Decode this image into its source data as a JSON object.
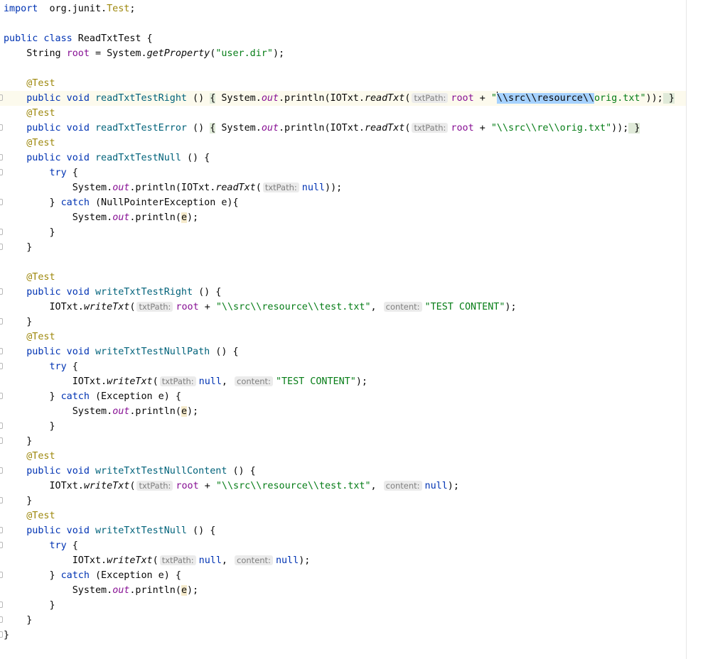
{
  "editor": {
    "lines": [
      {
        "tokens": [
          [
            "kw",
            "import"
          ],
          [
            "",
            "  org.junit."
          ],
          [
            "ann",
            "Test"
          ],
          [
            "",
            ";"
          ]
        ]
      },
      {
        "tokens": []
      },
      {
        "tokens": [
          [
            "kw",
            "public"
          ],
          [
            "",
            ""
          ],
          [
            "kw",
            " class"
          ],
          [
            "",
            " ReadTxtTest {"
          ]
        ]
      },
      {
        "tokens": [
          [
            "",
            "    String "
          ],
          [
            "fld",
            "root"
          ],
          [
            "",
            " = System."
          ],
          [
            "mi",
            "getProperty"
          ],
          [
            "",
            "("
          ],
          [
            "str",
            "\"user.dir\""
          ],
          [
            "",
            ");"
          ]
        ]
      },
      {
        "tokens": []
      },
      {
        "tokens": [
          [
            "ann",
            "    @Test"
          ]
        ]
      },
      {
        "tokens": [
          [
            "kw",
            "    public void "
          ],
          [
            "mdecl",
            "readTxtTestRight"
          ],
          [
            "",
            " () "
          ],
          [
            "brace-hl",
            "{"
          ],
          [
            "",
            " System."
          ],
          [
            "fldi",
            "out"
          ],
          [
            "",
            ".println(IOTxt."
          ],
          [
            "mi",
            "readTxt"
          ],
          [
            "",
            "("
          ],
          [
            "hint",
            "txtPath:"
          ],
          [
            "fld",
            "root"
          ],
          [
            "",
            " + "
          ],
          [
            "str",
            "\""
          ],
          [
            "caret",
            ""
          ],
          [
            "sel",
            "\\\\src\\\\resource\\\\"
          ],
          [
            "str",
            "orig.txt\""
          ],
          [
            "",
            "));"
          ],
          [
            "brace-hl",
            " }"
          ]
        ],
        "current": true
      },
      {
        "tokens": [
          [
            "ann",
            "    @Test"
          ]
        ]
      },
      {
        "tokens": [
          [
            "kw",
            "    public void "
          ],
          [
            "mdecl",
            "readTxtTestError"
          ],
          [
            "",
            " () "
          ],
          [
            "brace-hl",
            "{"
          ],
          [
            "",
            " System."
          ],
          [
            "fldi",
            "out"
          ],
          [
            "",
            ".println(IOTxt."
          ],
          [
            "mi",
            "readTxt"
          ],
          [
            "",
            "("
          ],
          [
            "hint",
            "txtPath:"
          ],
          [
            "fld",
            "root"
          ],
          [
            "",
            " + "
          ],
          [
            "str",
            "\"\\\\src\\\\re\\\\orig.txt\""
          ],
          [
            "",
            "));"
          ],
          [
            "brace-hl",
            " }"
          ]
        ]
      },
      {
        "tokens": [
          [
            "ann",
            "    @Test"
          ]
        ]
      },
      {
        "tokens": [
          [
            "kw",
            "    public void "
          ],
          [
            "mdecl",
            "readTxtTestNull"
          ],
          [
            "",
            " () {"
          ]
        ]
      },
      {
        "tokens": [
          [
            "kw",
            "        try"
          ],
          [
            "",
            " {"
          ]
        ]
      },
      {
        "tokens": [
          [
            "",
            "            System."
          ],
          [
            "fldi",
            "out"
          ],
          [
            "",
            ".println(IOTxt."
          ],
          [
            "mi",
            "readTxt"
          ],
          [
            "",
            "("
          ],
          [
            "hint",
            "txtPath:"
          ],
          [
            "nul",
            "null"
          ],
          [
            "",
            "));"
          ]
        ]
      },
      {
        "tokens": [
          [
            "",
            "        } "
          ],
          [
            "kw",
            "catch"
          ],
          [
            "",
            " (NullPointerException e){"
          ]
        ]
      },
      {
        "tokens": [
          [
            "",
            "            System."
          ],
          [
            "fldi",
            "out"
          ],
          [
            "",
            ".println("
          ],
          [
            "param-e",
            "e"
          ],
          [
            "",
            ");"
          ]
        ]
      },
      {
        "tokens": [
          [
            "",
            "        }"
          ]
        ]
      },
      {
        "tokens": [
          [
            "",
            "    }"
          ]
        ]
      },
      {
        "tokens": []
      },
      {
        "tokens": [
          [
            "ann",
            "    @Test"
          ]
        ]
      },
      {
        "tokens": [
          [
            "kw",
            "    public void "
          ],
          [
            "mdecl",
            "writeTxtTestRight"
          ],
          [
            "",
            " () {"
          ]
        ]
      },
      {
        "tokens": [
          [
            "",
            "        IOTxt."
          ],
          [
            "mi",
            "writeTxt"
          ],
          [
            "",
            "("
          ],
          [
            "hint",
            "txtPath:"
          ],
          [
            "fld",
            "root"
          ],
          [
            "",
            " + "
          ],
          [
            "str",
            "\"\\\\src\\\\resource\\\\test.txt\""
          ],
          [
            "",
            ", "
          ],
          [
            "hint",
            "content:"
          ],
          [
            "str",
            "\"TEST CONTENT\""
          ],
          [
            "",
            ");"
          ]
        ]
      },
      {
        "tokens": [
          [
            "",
            "    }"
          ]
        ]
      },
      {
        "tokens": [
          [
            "ann",
            "    @Test"
          ]
        ]
      },
      {
        "tokens": [
          [
            "kw",
            "    public void "
          ],
          [
            "mdecl",
            "writeTxtTestNullPath"
          ],
          [
            "",
            " () {"
          ]
        ]
      },
      {
        "tokens": [
          [
            "kw",
            "        try"
          ],
          [
            "",
            " {"
          ]
        ]
      },
      {
        "tokens": [
          [
            "",
            "            IOTxt."
          ],
          [
            "mi",
            "writeTxt"
          ],
          [
            "",
            "("
          ],
          [
            "hint",
            "txtPath:"
          ],
          [
            "nul",
            "null"
          ],
          [
            "",
            ", "
          ],
          [
            "hint",
            "content:"
          ],
          [
            "str",
            "\"TEST CONTENT\""
          ],
          [
            "",
            ");"
          ]
        ]
      },
      {
        "tokens": [
          [
            "",
            "        } "
          ],
          [
            "kw",
            "catch"
          ],
          [
            "",
            " (Exception e) {"
          ]
        ]
      },
      {
        "tokens": [
          [
            "",
            "            System."
          ],
          [
            "fldi",
            "out"
          ],
          [
            "",
            ".println("
          ],
          [
            "param-e",
            "e"
          ],
          [
            "",
            ");"
          ]
        ]
      },
      {
        "tokens": [
          [
            "",
            "        }"
          ]
        ]
      },
      {
        "tokens": [
          [
            "",
            "    }"
          ]
        ]
      },
      {
        "tokens": [
          [
            "ann",
            "    @Test"
          ]
        ]
      },
      {
        "tokens": [
          [
            "kw",
            "    public void "
          ],
          [
            "mdecl",
            "writeTxtTestNullContent"
          ],
          [
            "",
            " () {"
          ]
        ]
      },
      {
        "tokens": [
          [
            "",
            "        IOTxt."
          ],
          [
            "mi",
            "writeTxt"
          ],
          [
            "",
            "("
          ],
          [
            "hint",
            "txtPath:"
          ],
          [
            "fld",
            "root"
          ],
          [
            "",
            " + "
          ],
          [
            "str",
            "\"\\\\src\\\\resource\\\\test.txt\""
          ],
          [
            "",
            ", "
          ],
          [
            "hint",
            "content:"
          ],
          [
            "nul",
            "null"
          ],
          [
            "",
            ");"
          ]
        ]
      },
      {
        "tokens": [
          [
            "",
            "    }"
          ]
        ]
      },
      {
        "tokens": [
          [
            "ann",
            "    @Test"
          ]
        ]
      },
      {
        "tokens": [
          [
            "kw",
            "    public void "
          ],
          [
            "mdecl",
            "writeTxtTestNull"
          ],
          [
            "",
            " () {"
          ]
        ]
      },
      {
        "tokens": [
          [
            "kw",
            "        try"
          ],
          [
            "",
            " {"
          ]
        ]
      },
      {
        "tokens": [
          [
            "",
            "            IOTxt."
          ],
          [
            "mi",
            "writeTxt"
          ],
          [
            "",
            "("
          ],
          [
            "hint",
            "txtPath:"
          ],
          [
            "nul",
            "null"
          ],
          [
            "",
            ", "
          ],
          [
            "hint",
            "content:"
          ],
          [
            "nul",
            "null"
          ],
          [
            "",
            ");"
          ]
        ]
      },
      {
        "tokens": [
          [
            "",
            "        } "
          ],
          [
            "kw",
            "catch"
          ],
          [
            "",
            " (Exception e) {"
          ]
        ]
      },
      {
        "tokens": [
          [
            "",
            "            System."
          ],
          [
            "fldi",
            "out"
          ],
          [
            "",
            ".println("
          ],
          [
            "param-e",
            "e"
          ],
          [
            "",
            ");"
          ]
        ]
      },
      {
        "tokens": [
          [
            "",
            "        }"
          ]
        ]
      },
      {
        "tokens": [
          [
            "",
            "    }"
          ]
        ]
      },
      {
        "tokens": [
          [
            "",
            "}"
          ]
        ]
      }
    ],
    "fold_markers_on_lines": [
      6,
      8,
      10,
      11,
      13,
      15,
      16,
      19,
      21,
      23,
      24,
      26,
      28,
      29,
      31,
      33,
      35,
      36,
      38,
      40,
      41,
      42
    ]
  }
}
